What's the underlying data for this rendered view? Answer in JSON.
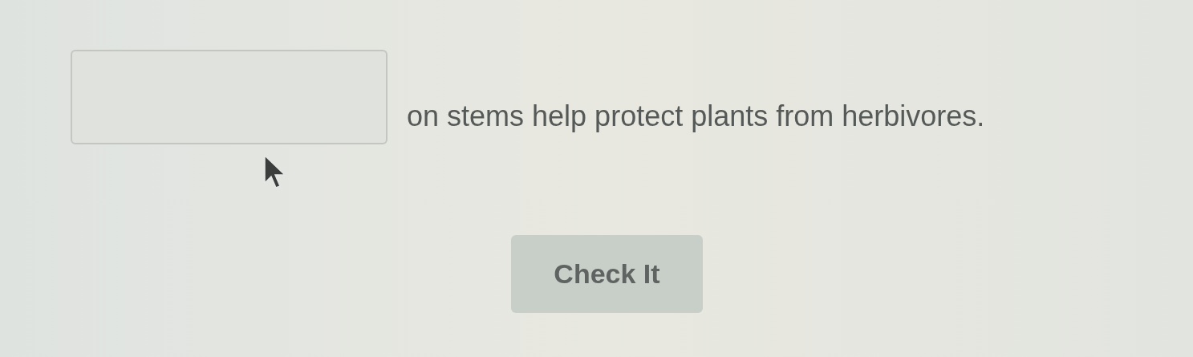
{
  "question": {
    "sentence": "on stems help protect plants from herbivores."
  },
  "button": {
    "label": "Check It"
  }
}
